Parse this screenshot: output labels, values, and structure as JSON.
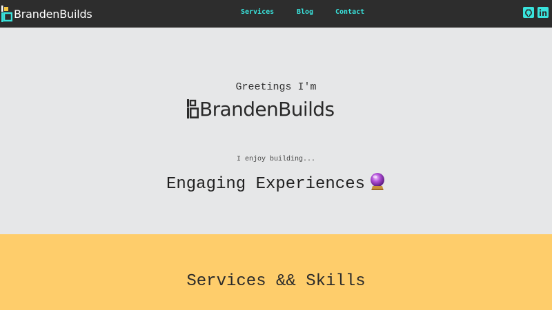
{
  "nav": {
    "brand": "BrandenBuilds",
    "links": [
      {
        "label": "Services"
      },
      {
        "label": "Blog"
      },
      {
        "label": "Contact"
      }
    ],
    "social": [
      {
        "icon": "github-icon"
      },
      {
        "icon": "linkedin-icon"
      }
    ]
  },
  "hero": {
    "greeting": "Greetings I'm",
    "brand": "BrandenBuilds",
    "enjoy": "I enjoy building...",
    "rotating_text": "Engaging Experiences",
    "rotating_icon": "crystal-ball-icon"
  },
  "services": {
    "title": "Services && Skills"
  },
  "colors": {
    "nav_bg": "#2d2d2d",
    "accent": "#39e3dc",
    "logo_yellow": "#f4c542",
    "hero_bg": "#e6e7e8",
    "services_bg": "#fecd6b"
  }
}
